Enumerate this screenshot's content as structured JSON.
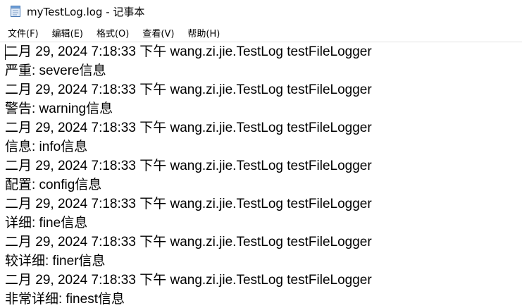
{
  "window": {
    "title": "myTestLog.log - 记事本",
    "icon": "notepad-icon"
  },
  "menu": [
    {
      "label": "文件(F)"
    },
    {
      "label": "编辑(E)"
    },
    {
      "label": "格式(O)"
    },
    {
      "label": "查看(V)"
    },
    {
      "label": "帮助(H)"
    }
  ],
  "editor": {
    "lines": [
      "二月 29, 2024 7:18:33 下午 wang.zi.jie.TestLog testFileLogger",
      "严重: severe信息",
      "二月 29, 2024 7:18:33 下午 wang.zi.jie.TestLog testFileLogger",
      "警告: warning信息",
      "二月 29, 2024 7:18:33 下午 wang.zi.jie.TestLog testFileLogger",
      "信息: info信息",
      "二月 29, 2024 7:18:33 下午 wang.zi.jie.TestLog testFileLogger",
      "配置: config信息",
      "二月 29, 2024 7:18:33 下午 wang.zi.jie.TestLog testFileLogger",
      "详细: fine信息",
      "二月 29, 2024 7:18:33 下午 wang.zi.jie.TestLog testFileLogger",
      "较详细: finer信息",
      "二月 29, 2024 7:18:33 下午 wang.zi.jie.TestLog testFileLogger",
      "非常详细: finest信息"
    ]
  }
}
